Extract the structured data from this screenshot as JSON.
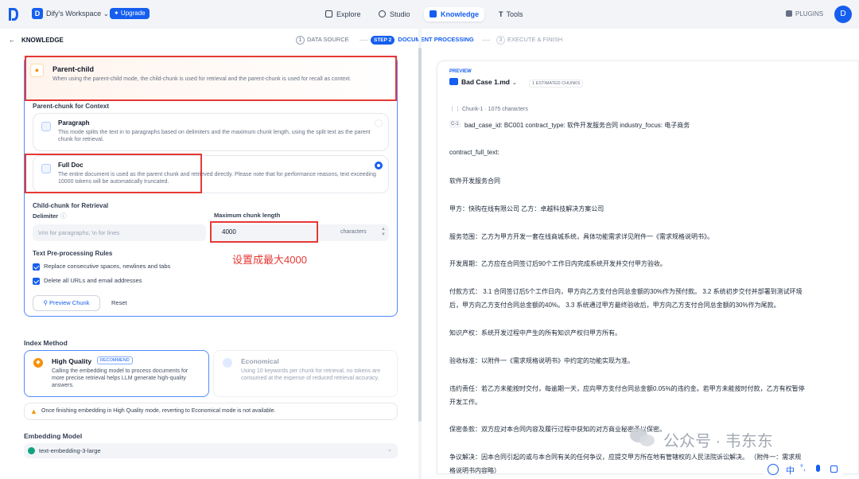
{
  "nav": {
    "workspace_initial": "D",
    "workspace_name": "Dify's Workspace ⌄",
    "upgrade_label": "✦ Upgrade",
    "items": [
      {
        "label": "Explore",
        "icon": "compass-icon"
      },
      {
        "label": "Studio",
        "icon": "studio-icon"
      },
      {
        "label": "Knowledge",
        "icon": "knowledge-icon"
      },
      {
        "label": "Tools",
        "icon": "tools-icon"
      }
    ],
    "plugins_label": "PLUGINS",
    "avatar_initial": "D"
  },
  "header": {
    "back_label": "KNOWLEDGE",
    "steps": [
      {
        "num": "1",
        "label": "DATA SOURCE"
      },
      {
        "num": "STEP 2",
        "label": "DOCUMENT PROCESSING"
      },
      {
        "num": "3",
        "label": "EXECUTE & FINISH"
      }
    ]
  },
  "parent_child": {
    "title": "Parent-child",
    "desc": "When using the parent-child mode, the child-chunk is used for retrieval and the parent-chunk is used for recall as context.",
    "parent_section": "Parent-chunk for Context",
    "paragraph_title": "Paragraph",
    "paragraph_desc": "This mode splits the text in to paragraphs based on delimiters and the maximum chunk length, using the split text as the parent chunk for retrieval.",
    "fulldoc_title": "Full Doc",
    "fulldoc_desc": "The entire document is used as the parent chunk and retrieved directly. Please note that for performance reasons, text exceeding 10000 tokens will be automatically truncated.",
    "child_section": "Child-chunk for Retrieval",
    "delimiter_label": "Delimiter",
    "delimiter_placeholder": "\\n\\n for paragraphs; \\n for lines",
    "maxlen_label": "Maximum chunk length",
    "maxlen_value": "4000",
    "maxlen_unit": "characters",
    "annotation": "设置成最大4000",
    "rules_label": "Text Pre-processing Rules",
    "rule1": "Replace consecutive spaces, newlines and tabs",
    "rule2": "Delete all URLs and email addresses",
    "preview_btn": "Preview Chunk",
    "reset_btn": "Reset"
  },
  "index": {
    "label": "Index Method",
    "hq_title": "High Quality",
    "hq_badge": "RECOMMEND",
    "hq_desc": "Calling the embedding model to process documents for more precise retrieval helps LLM generate high-quality answers.",
    "eco_title": "Economical",
    "eco_desc": "Using 10 keywords per chunk for retrieval, no tokens are consumed at the expense of reduced retrieval accuracy.",
    "warning": "Once finishing embedding in High Quality mode, reverting to Economical mode is not available."
  },
  "embedding": {
    "label": "Embedding Model",
    "model": "text-embedding-3-large"
  },
  "preview": {
    "label": "PREVIEW",
    "file": "Bad Case 1.md",
    "chunks_badge": "1 ESTIMATED CHUNKS",
    "chunk_meta": "Chunk-1 · 1075 characters",
    "child_tag": "C-1",
    "lines": [
      "bad_case_id: BC001 contract_type: 软件开发服务合同 industry_focus: 电子商务",
      "contract_full_text:",
      "软件开发服务合同",
      "甲方：快购在线有限公司 乙方：卓越科技解决方案公司",
      "服务范围：乙方为甲方开发一套在线商城系统，具体功能需求详见附件一《需求规格说明书》。",
      "开发周期：乙方应在合同签订后90个工作日内完成系统开发并交付甲方验收。",
      "付款方式： 3.1 合同签订后5个工作日内，甲方向乙方支付合同总金额的30%作为预付款。 3.2 系统初步交付并部署到测试环境",
      "后，甲方向乙方支付合同总金额的40%。 3.3 系统通过甲方最终验收后，甲方向乙方支付合同总金额的30%作为尾款。",
      "知识产权：系统开发过程中产生的所有知识产权归甲方所有。",
      "验收标准：以附件一《需求规格说明书》中约定的功能实现为准。",
      "违约责任：若乙方未能按时交付，每逾期一天，应向甲方支付合同总金额0.05%的违约金。若甲方未能按时付款，乙方有权暂停",
      "开发工作。",
      "保密条款：双方应对本合同内容及履行过程中获知的对方商业秘密予以保密。",
      "争议解决：因本合同引起的或与本合同有关的任何争议，应提交甲方所在地有管辖权的人民法院诉讼解决。 （附件一：需求规",
      "格说明书内容略）"
    ]
  },
  "watermark": "公众号 · 韦东东",
  "ime": {
    "label": "中",
    "punct": "°,"
  },
  "colors": {
    "accent": "#155eef",
    "red_annotation": "#e53935"
  }
}
